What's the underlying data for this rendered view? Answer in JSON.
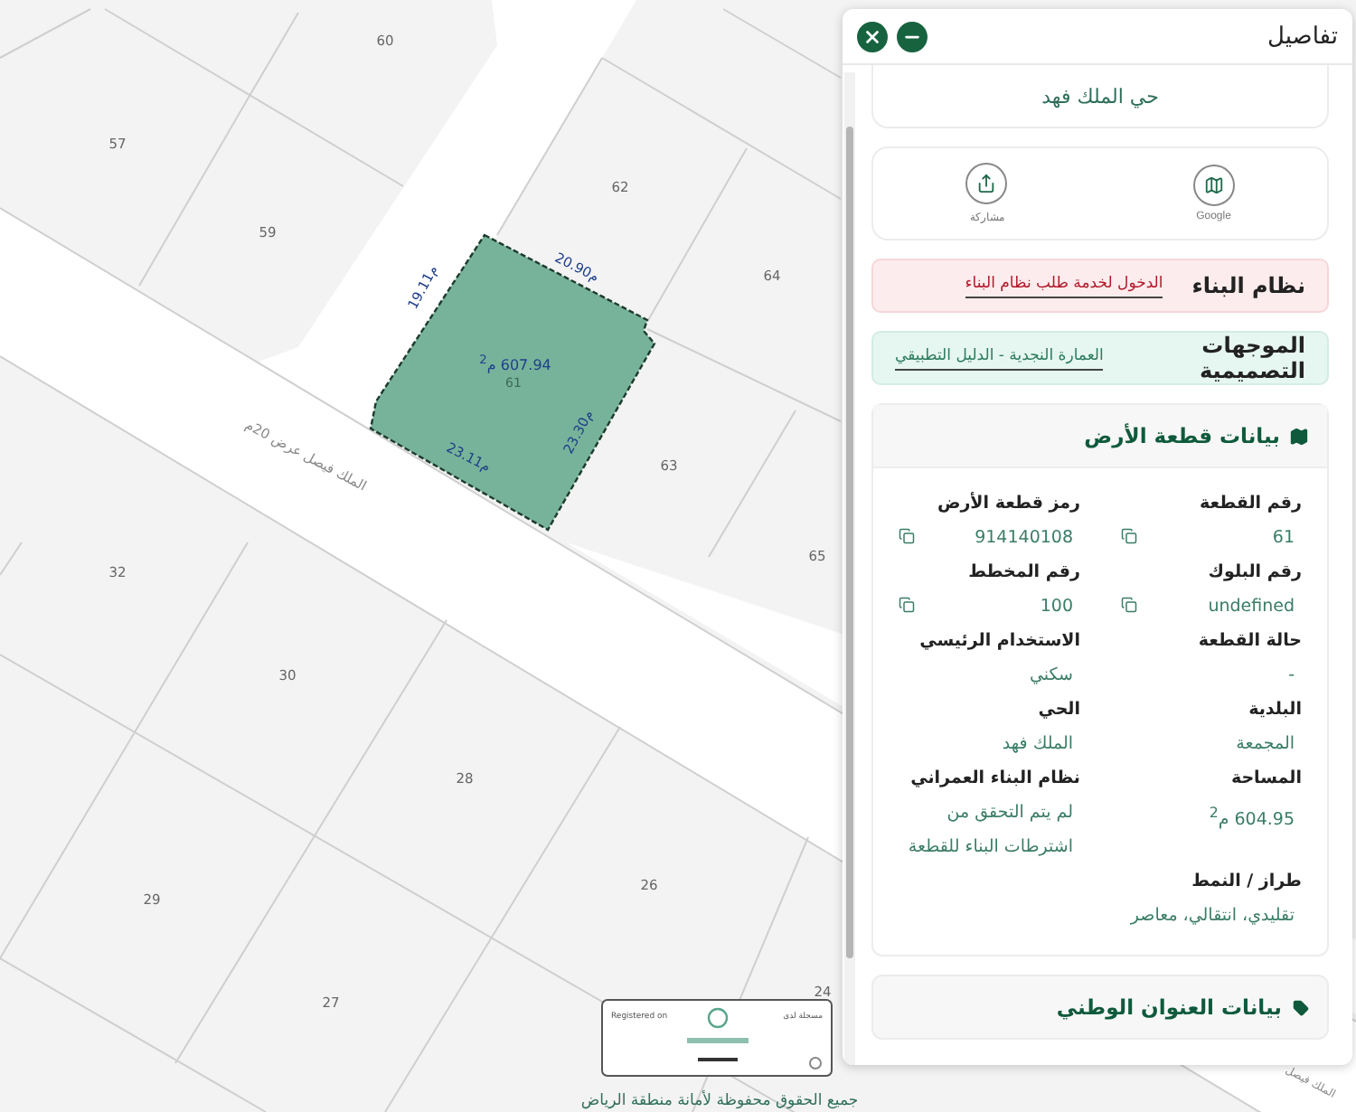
{
  "map": {
    "parcels": [
      {
        "label": "60"
      },
      {
        "label": "57"
      },
      {
        "label": "59"
      },
      {
        "label": "62"
      },
      {
        "label": "64"
      },
      {
        "label": "63"
      },
      {
        "label": "65"
      },
      {
        "label": "32"
      },
      {
        "label": "30"
      },
      {
        "label": "28"
      },
      {
        "label": "29"
      },
      {
        "label": "26"
      },
      {
        "label": "27"
      },
      {
        "label": "24"
      }
    ],
    "plot": {
      "number": "61",
      "area": "607.94 م$^{2}$",
      "selected": true,
      "sides": [
        {
          "label": "20.90م"
        },
        {
          "label": "19.11م"
        },
        {
          "label": "23.30م"
        },
        {
          "label": "23.11م"
        }
      ]
    },
    "street_labels": [
      {
        "label": "الملك فيصل عرض 20م"
      },
      {
        "label": "الملك فيصل"
      }
    ],
    "badge": {
      "left": "Registered on",
      "right": "مسجلة لدى"
    },
    "copyright": "جميع الحقوق محفوظة لأمانة منطقة الرياض"
  },
  "panel": {
    "title": "تفاصيل",
    "neighborhood": "حي الملك فهد",
    "actions": [
      {
        "kind": "map",
        "label": "Google"
      },
      {
        "kind": "share",
        "label": "مشاركة"
      }
    ],
    "building_system": {
      "label": "نظام البناء",
      "link": "الدخول لخدمة طلب نظام البناء"
    },
    "design_guidelines": {
      "label": "الموجهات التصميمية",
      "link": "العمارة النجدية - الدليل التطبيقي"
    },
    "land_data": {
      "title": "بيانات قطعة الأرض",
      "fields": [
        {
          "label": "رقم القطعة",
          "value": "61",
          "copyable": true
        },
        {
          "label": "رمز قطعة الأرض",
          "value": "914140108",
          "copyable": true
        },
        {
          "label": "رقم البلوك",
          "value": "undefined",
          "copyable": true
        },
        {
          "label": "رقم المخطط",
          "value": "100",
          "copyable": true
        },
        {
          "label": "حالة القطعة",
          "value": "-",
          "copyable": false
        },
        {
          "label": "الاستخدام الرئيسي",
          "value": "سكني",
          "copyable": false
        },
        {
          "label": "البلدية",
          "value": "المجمعة",
          "copyable": false
        },
        {
          "label": "الحي",
          "value": "الملك فهد",
          "copyable": false
        },
        {
          "label": "المساحة",
          "value": "604.95 م$^{2}$",
          "copyable": false
        },
        {
          "label": "نظام البناء العمراني",
          "value": "لم يتم التحقق من اشترطات البناء للقطعة",
          "copyable": false
        },
        {
          "label": "طراز / النمط",
          "value": "تقليدي، انتقالي، معاصر",
          "copyable": false
        }
      ]
    },
    "address_section": {
      "title": "بيانات العنوان الوطني"
    }
  }
}
